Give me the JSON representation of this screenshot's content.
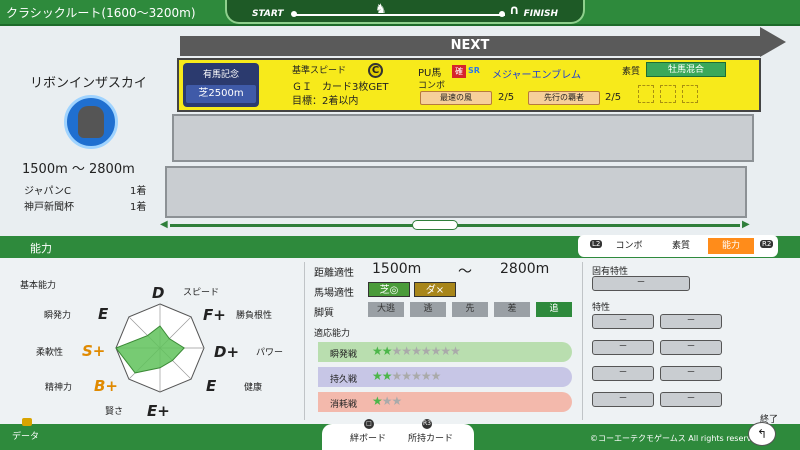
{
  "header": {
    "route_title": "クラシックルート(1600～3200m)",
    "start_label": "START",
    "finish_label": "FINISH"
  },
  "next_label": "NEXT",
  "horse": {
    "name": "リボンインザスカイ",
    "distance_range": "1500m ～ 2800m",
    "records": [
      {
        "race": "ジャパンC",
        "result": "1着"
      },
      {
        "race": "神戸新聞杯",
        "result": "1着"
      }
    ]
  },
  "next_race": {
    "race_name": "有馬記念",
    "course": "芝2500m",
    "base_speed_label": "基準スピード",
    "base_speed_grade": "C",
    "grade_card": "ＧＩ　カード3枚GET",
    "goal": "目標：2着以内",
    "pu_label": "PU馬",
    "kaku_label": "確",
    "sr_label": "SR",
    "pu_name": "メジャーエンブレム",
    "combo_label": "コンボ",
    "combos": [
      {
        "name": "最速の風",
        "count": "2/5"
      },
      {
        "name": "先行の覇者",
        "count": "2/5"
      }
    ],
    "trait_label": "素質",
    "trait_value": "牡馬混合"
  },
  "ability_bar": {
    "title": "能力",
    "tabs": [
      "コンボ",
      "素質",
      "能力"
    ],
    "active_tab": "能力",
    "left_hint": "L2",
    "right_hint": "R2"
  },
  "basic": {
    "title": "基本能力",
    "stats": [
      {
        "name": "スピード",
        "grade": "D",
        "value": 0.5
      },
      {
        "name": "勝負根性",
        "grade": "F+",
        "value": 0.3
      },
      {
        "name": "パワー",
        "grade": "D+",
        "value": 0.55
      },
      {
        "name": "健康",
        "grade": "E",
        "value": 0.4
      },
      {
        "name": "賢さ",
        "grade": "E+",
        "value": 0.45
      },
      {
        "name": "精神力",
        "grade": "B+",
        "value": 0.8
      },
      {
        "name": "柔軟性",
        "grade": "S+",
        "value": 1.0
      },
      {
        "name": "瞬発力",
        "grade": "E",
        "value": 0.4
      }
    ]
  },
  "aptitude": {
    "distance_label": "距離適性",
    "distance_min": "1500m",
    "distance_sep": "～",
    "distance_max": "2800m",
    "ground_label": "馬場適性",
    "turf": "芝◎",
    "dirt": "ダ×",
    "leg_label": "脚質",
    "legs": [
      "大逃",
      "逃",
      "先",
      "差",
      "追"
    ],
    "active_leg": "追",
    "adapt_label": "適応能力",
    "adapts": [
      {
        "name": "瞬発戦",
        "on": 2,
        "total": 9,
        "color": "#b9deaf"
      },
      {
        "name": "持久戦",
        "on": 2,
        "total": 7,
        "color": "#c7c6e6"
      },
      {
        "name": "消耗戦",
        "on": 1,
        "total": 3,
        "color": "#f3b9ac"
      }
    ]
  },
  "traits": {
    "unique_label": "固有特性",
    "unique_value": "－",
    "trait_label": "特性",
    "slots": [
      "－",
      "－",
      "－",
      "－",
      "－",
      "－",
      "－",
      "－"
    ]
  },
  "footer": {
    "data_label": "データ",
    "btn_board": "絆ボード",
    "btn_cards": "所持カード",
    "end_label": "終了",
    "copyright": "©コーエーテクモゲームス All rights reserved."
  }
}
